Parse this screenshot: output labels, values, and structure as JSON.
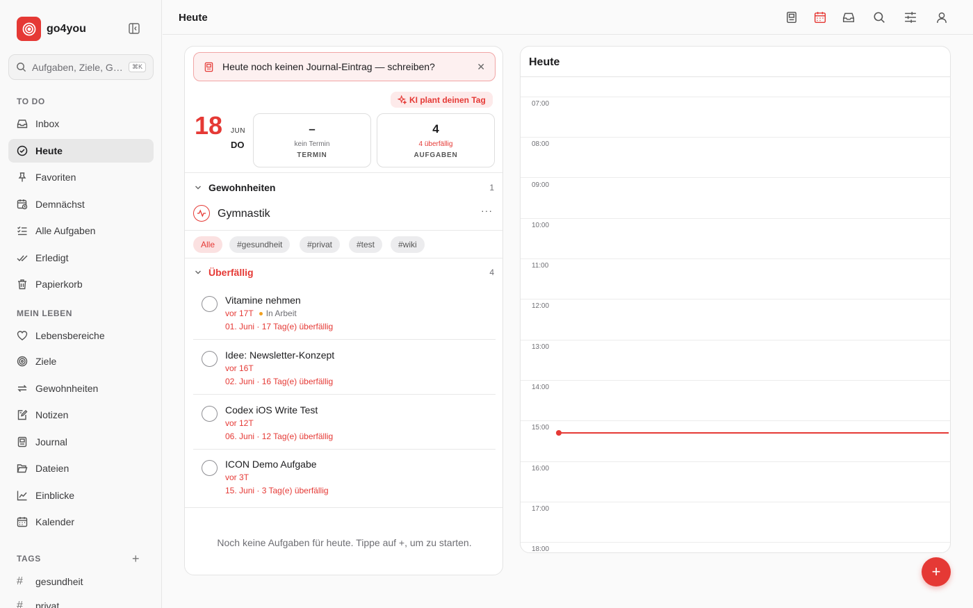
{
  "app": {
    "name": "go4you"
  },
  "search": {
    "placeholder": "Aufgaben, Ziele, G…",
    "shortcut": "⌘K"
  },
  "sidebar": {
    "todo_label": "TO DO",
    "todo_items": [
      {
        "label": "Inbox",
        "icon": "inbox-icon"
      },
      {
        "label": "Heute",
        "icon": "check-circle-icon",
        "active": true
      },
      {
        "label": "Favoriten",
        "icon": "pin-icon"
      },
      {
        "label": "Demnächst",
        "icon": "calendar-clock-icon"
      },
      {
        "label": "Alle Aufgaben",
        "icon": "list-check-icon"
      },
      {
        "label": "Erledigt",
        "icon": "double-check-icon"
      },
      {
        "label": "Papierkorb",
        "icon": "trash-icon"
      }
    ],
    "life_label": "MEIN LEBEN",
    "life_items": [
      {
        "label": "Lebensbereiche",
        "icon": "heart-icon"
      },
      {
        "label": "Ziele",
        "icon": "target-icon"
      },
      {
        "label": "Gewohnheiten",
        "icon": "repeat-icon"
      },
      {
        "label": "Notizen",
        "icon": "note-edit-icon"
      },
      {
        "label": "Journal",
        "icon": "journal-icon"
      },
      {
        "label": "Dateien",
        "icon": "folder-icon"
      },
      {
        "label": "Einblicke",
        "icon": "chart-line-icon"
      },
      {
        "label": "Kalender",
        "icon": "calendar-icon"
      }
    ],
    "tags_label": "TAGS",
    "tags": [
      "gesundheit",
      "privat"
    ]
  },
  "topbar": {
    "title": "Heute",
    "icons": [
      "journal-icon",
      "calendar-icon",
      "inbox-icon",
      "search-icon",
      "sliders-icon",
      "user-icon"
    ]
  },
  "main": {
    "banner": {
      "text": "Heute noch keinen Journal-Eintrag — schreiben?",
      "close": "✕"
    },
    "ai_button": "KI plant deinen Tag",
    "date": {
      "day": "18",
      "month": "JUN",
      "weekday": "DO"
    },
    "stats": [
      {
        "value": "–",
        "sub": "kein Termin",
        "caption": "TERMIN",
        "sub_color": "gray"
      },
      {
        "value": "4",
        "sub": "4 überfällig",
        "caption": "AUFGABEN",
        "sub_color": "red"
      }
    ],
    "habits": {
      "title": "Gewohnheiten",
      "count": "1",
      "items": [
        {
          "name": "Gymnastik",
          "more": "···"
        }
      ]
    },
    "filters": [
      "Alle",
      "#gesundheit",
      "#privat",
      "#test",
      "#wiki"
    ],
    "overdue": {
      "title": "Überfällig",
      "count": "4",
      "tasks": [
        {
          "title": "Vitamine nehmen",
          "age": "vor 17T",
          "status": "In Arbeit",
          "due": "01. Juni · 17 Tag(e) überfällig"
        },
        {
          "title": "Idee: Newsletter-Konzept",
          "age": "vor 16T",
          "status": "",
          "due": "02. Juni · 16 Tag(e) überfällig"
        },
        {
          "title": "Codex iOS Write Test",
          "age": "vor 12T",
          "status": "",
          "due": "06. Juni · 12 Tag(e) überfällig"
        },
        {
          "title": "ICON Demo Aufgabe",
          "age": "vor 3T",
          "status": "",
          "due": "15. Juni · 3 Tag(e) überfällig"
        }
      ]
    },
    "empty_hint": "Noch keine Aufgaben für heute. Tippe auf +, um zu starten."
  },
  "calendar": {
    "title": "Heute",
    "hours": [
      "07:00",
      "08:00",
      "09:00",
      "10:00",
      "11:00",
      "12:00",
      "13:00",
      "14:00",
      "15:00",
      "16:00",
      "17:00",
      "18:00"
    ],
    "now_time": "15:08"
  },
  "fab": {
    "label": "+"
  },
  "colors": {
    "accent": "#e53935",
    "accent_bg": "#fdf0f0",
    "status_dot": "#f0a020"
  }
}
